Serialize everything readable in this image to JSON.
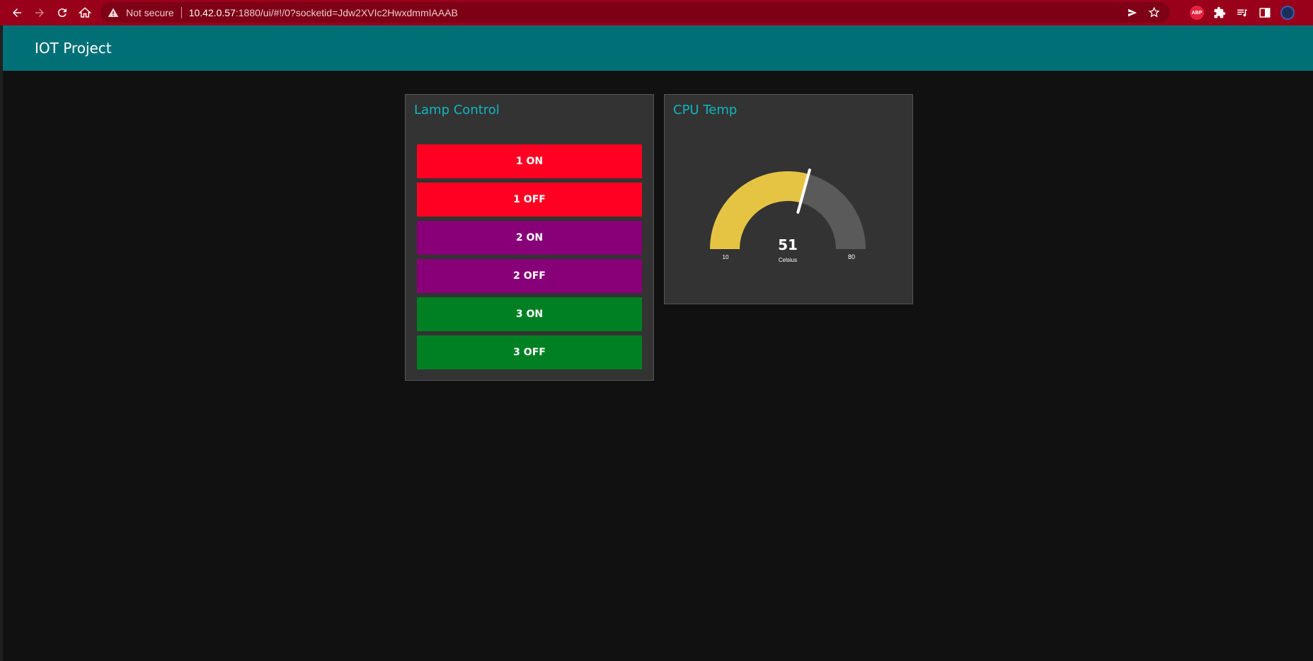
{
  "browser": {
    "security_label": "Not secure",
    "url_host": "10.42.0.57",
    "url_rest": ":1880/ui/#!/0?socketid=Jdw2XVIc2HwxdmmIAAAB",
    "extension_abp": "ABP"
  },
  "app": {
    "title": "IOT Project"
  },
  "lamp_control": {
    "title": "Lamp Control",
    "buttons": [
      {
        "label": "1 ON",
        "color": "#ff0022"
      },
      {
        "label": "1 OFF",
        "color": "#ff0022"
      },
      {
        "label": "2 ON",
        "color": "#880077"
      },
      {
        "label": "2 OFF",
        "color": "#880077"
      },
      {
        "label": "3 ON",
        "color": "#008022"
      },
      {
        "label": "3 OFF",
        "color": "#008022"
      }
    ]
  },
  "cpu_temp": {
    "title": "CPU Temp",
    "value": "51",
    "units": "Celsius",
    "min": "10",
    "max": "80",
    "fill_color": "#e6c443",
    "track_color": "#5a5a5a"
  },
  "colors": {
    "chrome": "#99001a",
    "toolbar": "#007077",
    "background": "#111111",
    "card": "#333333",
    "card_title": "#0eb8c0"
  }
}
